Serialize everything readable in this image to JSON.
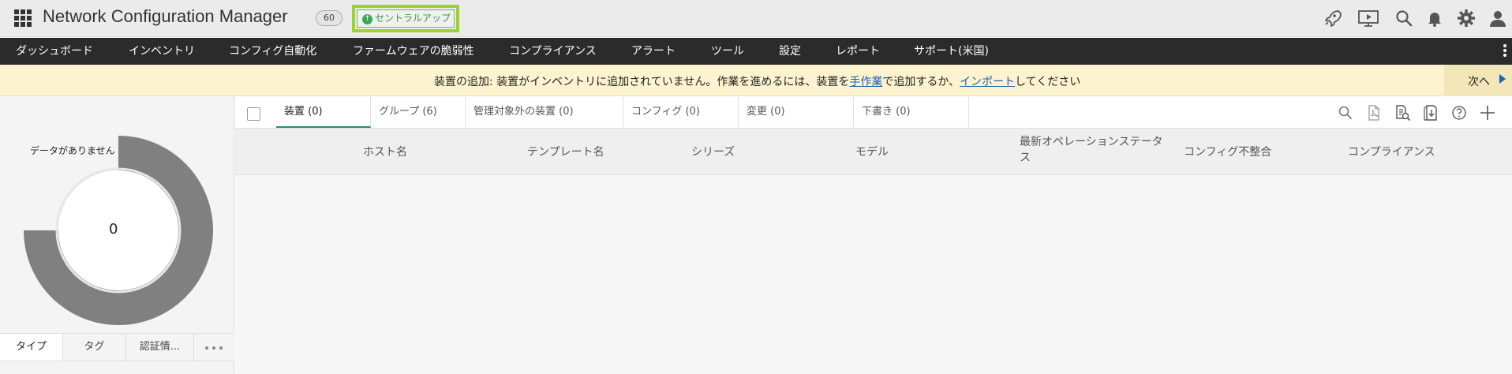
{
  "header": {
    "app_title": "Network Configuration Manager",
    "count_badge": "60",
    "central_label": "セントラルアップ",
    "icons": [
      "rocket-icon",
      "presentation-icon",
      "search-icon",
      "bell-icon",
      "gear-icon",
      "user-icon"
    ]
  },
  "nav": {
    "items": [
      "ダッシュボード",
      "インベントリ",
      "コンフィグ自動化",
      "ファームウェアの脆弱性",
      "コンプライアンス",
      "アラート",
      "ツール",
      "設定",
      "レポート",
      "サポート(米国)"
    ]
  },
  "banner": {
    "prefix": "装置の追加: 装置がインベントリに追加されていません。作業を進めるには、装置を",
    "link1": "手作業",
    "middle": "で追加するか、",
    "link2": "インポート",
    "suffix": "してください",
    "next": "次へ"
  },
  "left": {
    "no_data": "データがありません",
    "donut_value": "0",
    "tabs": [
      "タイプ",
      "タグ",
      "認証情..."
    ]
  },
  "main": {
    "tabs": [
      "装置 (0)",
      "グループ (6)",
      "管理対象外の装置 (0)",
      "コンフィグ (0)",
      "変更 (0)",
      "下書き (0)"
    ],
    "columns": [
      "ホスト名",
      "テンプレート名",
      "シリーズ",
      "モデル",
      "最新オペレーションステータス",
      "コンフィグ不整合",
      "コンプライアンス"
    ]
  },
  "colors": {
    "accent": "#2d8f5a",
    "highlight": "#9ad42c",
    "nav_bg": "#2b2b2b",
    "banner_bg": "#fdf3cf"
  }
}
